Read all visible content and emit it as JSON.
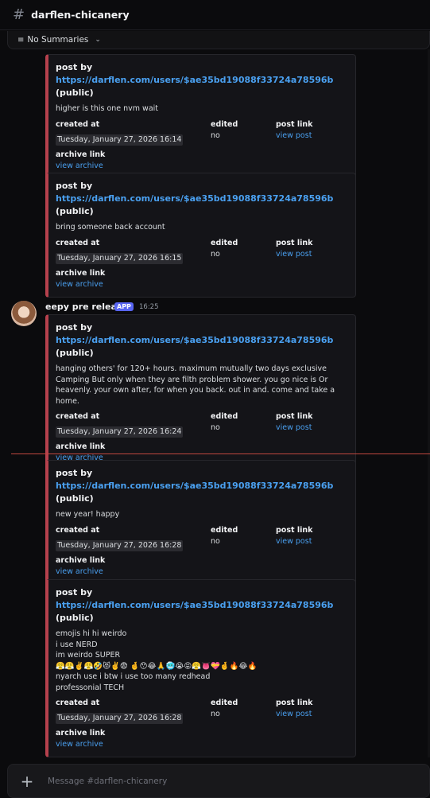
{
  "channel": {
    "hash": "#",
    "name": "darflen-chicanery"
  },
  "summaries": {
    "icon": "≡",
    "label": "No Summaries",
    "chevron": "⌄"
  },
  "labels": {
    "post_by": "post by",
    "public": "(public)",
    "created_at": "created at",
    "edited": "edited",
    "post_link": "post link",
    "archive_link": "archive link",
    "view_post": "view post",
    "view_archive": "view archive",
    "edited_value": "no"
  },
  "author": {
    "name": "eepy pre release",
    "badge": "APP",
    "time": "16:25"
  },
  "posts": [
    {
      "user_url": "https://darflen.com/users/$ae35bd19088f33724a78596b",
      "text": "higher is this one nvm wait",
      "created": "Tuesday, January 27, 2026 16:14"
    },
    {
      "user_url": "https://darflen.com/users/$ae35bd19088f33724a78596b",
      "text": "bring someone back account",
      "created": "Tuesday, January 27, 2026 16:15"
    },
    {
      "user_url": "https://darflen.com/users/$ae35bd19088f33724a78596b",
      "text": "hanging others' for 120+ hours. maximum mutually two days exclusive Camping But only when they are filth problem shower. you go nice is Or heavenly. your own after, for when you back. out in and. come and take a home.",
      "created": "Tuesday, January 27, 2026 16:24"
    },
    {
      "user_url": "https://darflen.com/users/$ae35bd19088f33724a78596b",
      "text": "new year! happy",
      "created": "Tuesday, January 27, 2026 16:28"
    },
    {
      "user_url": "https://darflen.com/users/$ae35bd19088f33724a78596b",
      "text": "emojis hi hi weirdo\ni use NERD\nim weirdo SUPER\n😤😤✌️😤🤣😻✌️😨 🤞😯😂🙏🥶😭😝😤👅💝🤞🔥😂🔥\nnyarch use i btw i use too many redhead\nprofessonial TECH",
      "created": "Tuesday, January 27, 2026 16:28"
    }
  ],
  "composer": {
    "plus": "+",
    "placeholder": "Message #darflen-chicanery"
  }
}
